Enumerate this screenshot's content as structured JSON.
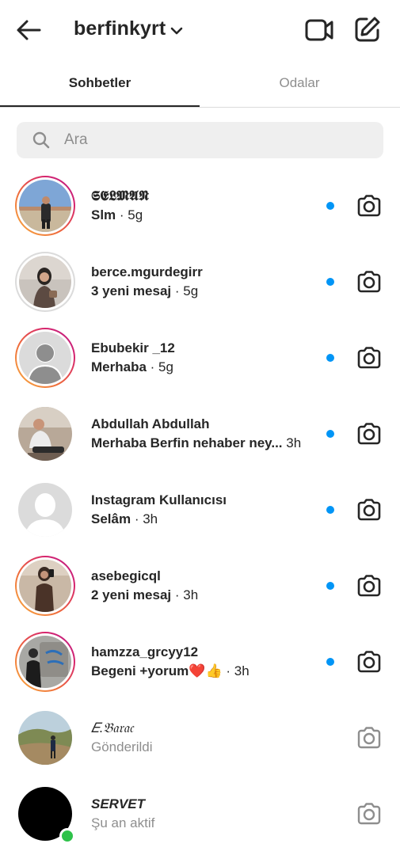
{
  "header": {
    "title": "berfinkyrt",
    "icons": [
      "back-arrow-icon",
      "chevron-down-icon",
      "video-camera-icon",
      "new-message-icon"
    ]
  },
  "tabs": [
    {
      "label": "Sohbetler",
      "active": true
    },
    {
      "label": "Odalar",
      "active": false
    }
  ],
  "search": {
    "placeholder": "Ara"
  },
  "colors": {
    "unread": "#0095f6",
    "online": "#2ec24a",
    "secondary_text": "#8e8e8e"
  },
  "conversations": [
    {
      "name": "𝕾𝕰𝕷𝕸𝕬𝕹",
      "message": "Slm",
      "time": "· 5g",
      "unread": true,
      "ring": "story"
    },
    {
      "name": "berce.mgurdegirr",
      "message": "3 yeni mesaj",
      "time": "· 5g",
      "unread": true,
      "ring": "seen"
    },
    {
      "name": "Ebubekir _12",
      "message": "Merhaba",
      "time": "· 5g",
      "unread": true,
      "ring": "story"
    },
    {
      "name": "Abdullah Abdullah",
      "message": "Merhaba Berfin nehaber ney...",
      "time": "3h",
      "unread": true,
      "ring": "none"
    },
    {
      "name": "Instagram Kullanıcısı",
      "message": "Selâm",
      "time": "· 3h",
      "unread": true,
      "ring": "none"
    },
    {
      "name": "asebegicql",
      "message": "2 yeni mesaj",
      "time": "· 3h",
      "unread": true,
      "ring": "story"
    },
    {
      "name": "hamzza_grcyy12",
      "message": "Begeni +yorum❤️👍",
      "time": "· 3h",
      "unread": true,
      "ring": "story"
    },
    {
      "name": "𝐸.𝔅𝔞𝔯𝔞𝔠",
      "message": "Gönderildi",
      "time": "",
      "unread": false,
      "ring": "none"
    },
    {
      "name": "SERVET",
      "message": "Şu an aktif",
      "time": "",
      "unread": false,
      "ring": "none",
      "online": true
    }
  ]
}
